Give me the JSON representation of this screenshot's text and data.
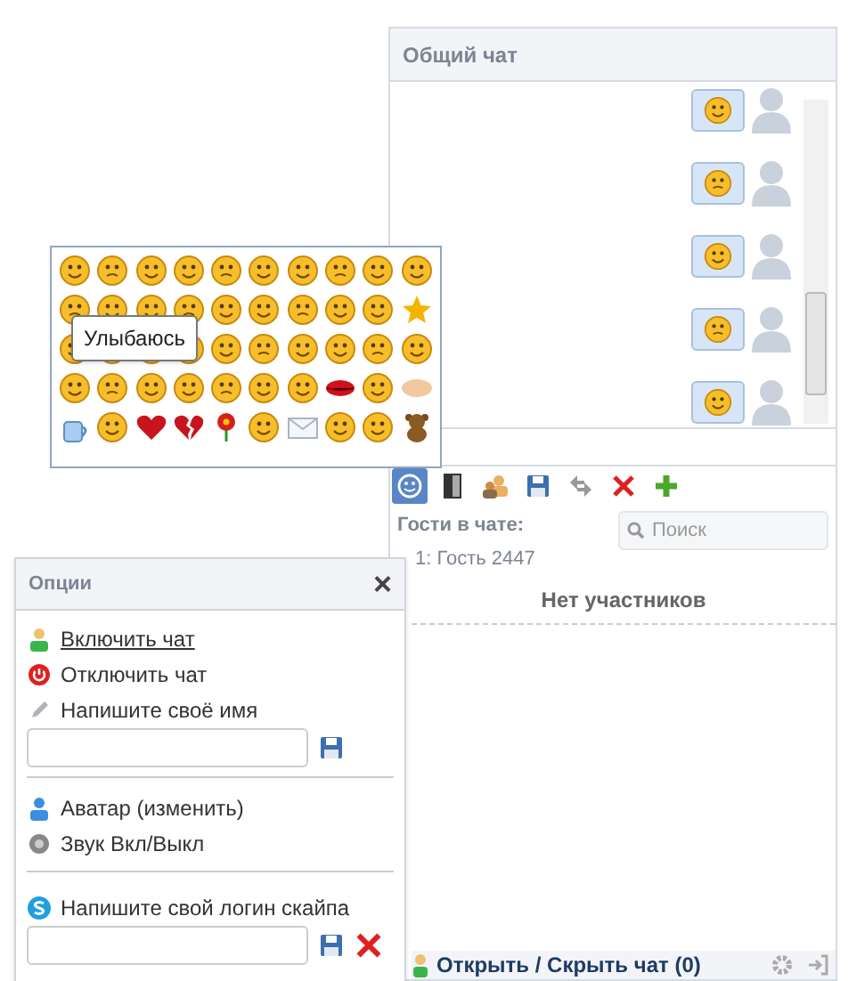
{
  "chat": {
    "title": "Общий чат",
    "toolbar": [
      {
        "kind": "smiley",
        "selected": true
      },
      {
        "kind": "door",
        "selected": false
      },
      {
        "kind": "people",
        "selected": false
      },
      {
        "kind": "save",
        "selected": false
      },
      {
        "kind": "refresh",
        "selected": false
      },
      {
        "kind": "delete",
        "selected": false
      },
      {
        "kind": "add",
        "selected": false
      }
    ],
    "guests_label": "Гости в чате:",
    "guests": [
      "1: Гость 2447"
    ],
    "search": {
      "placeholder": "Поиск"
    },
    "participants_empty": "Нет участников",
    "footer": "Открыть / Скрыть чат (0)"
  },
  "emoji_picker": {
    "tooltip": "Улыбаюсь"
  },
  "options": {
    "title": "Опции",
    "close": "×",
    "items": [
      {
        "kind": "enable",
        "label": "Включить чат",
        "hovered": true
      },
      {
        "kind": "disable",
        "label": "Отключить чат",
        "hovered": false
      },
      {
        "kind": "name",
        "label": "Напишите своё имя",
        "hovered": false
      },
      {
        "kind": "avatar",
        "label": "Аватар (изменить)",
        "hovered": false
      },
      {
        "kind": "sound",
        "label": "Звук Вкл/Выкл",
        "hovered": false
      },
      {
        "kind": "skype",
        "label": "Напишите свой логин скайпа",
        "hovered": false
      }
    ]
  }
}
